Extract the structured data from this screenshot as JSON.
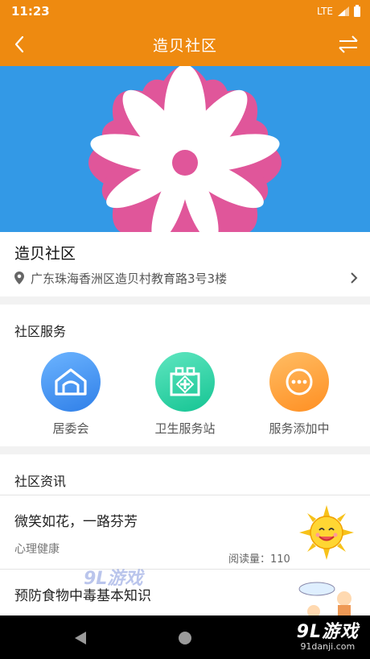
{
  "status_bar": {
    "time": "11:23",
    "network": "LTE"
  },
  "app_bar": {
    "title": "造贝社区"
  },
  "community": {
    "name": "造贝社区",
    "address": "广东珠海香洲区造贝村教育路3号3楼"
  },
  "services": {
    "title": "社区服务",
    "items": [
      {
        "label": "居委会",
        "icon": "house-icon",
        "color": "#3a8ff0"
      },
      {
        "label": "卫生服务站",
        "icon": "clinic-icon",
        "color": "#26d0a0"
      },
      {
        "label": "服务添加中",
        "icon": "more-icon",
        "color": "#ff9a30"
      }
    ]
  },
  "news": {
    "title": "社区资讯",
    "items": [
      {
        "title": "微笑如花，一路芬芳",
        "category": "心理健康",
        "reads": "阅读量：110",
        "thumb": "smiling-sun-image"
      },
      {
        "title": "预防食物中毒基本知识",
        "category": "",
        "reads": "",
        "thumb": "cartoon-image"
      }
    ]
  },
  "watermark": {
    "text": "9L游戏"
  },
  "brand": {
    "logo": "9L游戏",
    "site": "91danji.com"
  },
  "colors": {
    "accent": "#ee8a10",
    "banner_bg": "#3399e6",
    "petal_pink": "#e0569a"
  }
}
